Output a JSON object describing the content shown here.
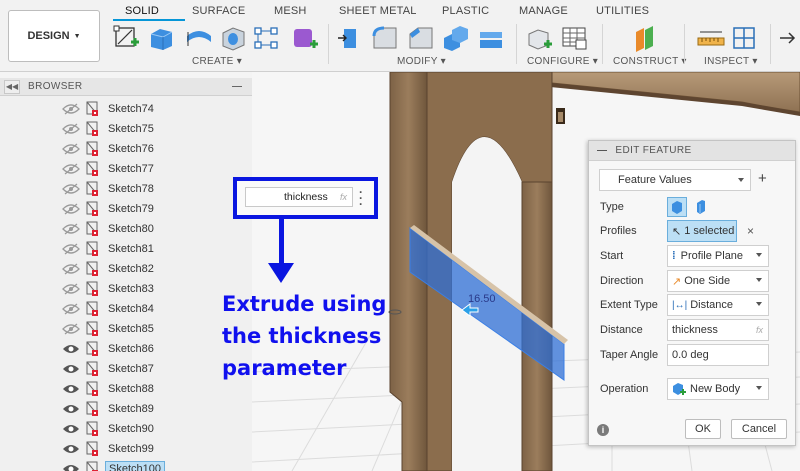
{
  "toolbar": {
    "workspace_label": "DESIGN",
    "tabs": [
      "SOLID",
      "SURFACE",
      "MESH",
      "SHEET METAL",
      "PLASTIC",
      "MANAGE",
      "UTILITIES"
    ],
    "active_tab": "SOLID",
    "groups": [
      "CREATE",
      "MODIFY",
      "CONFIGURE",
      "CONSTRUCT",
      "INSPECT"
    ],
    "accent_color": "#0696d7"
  },
  "browser": {
    "title": "BROWSER",
    "items": [
      {
        "label": "Sketch74",
        "visible": false
      },
      {
        "label": "Sketch75",
        "visible": false
      },
      {
        "label": "Sketch76",
        "visible": false
      },
      {
        "label": "Sketch77",
        "visible": false
      },
      {
        "label": "Sketch78",
        "visible": false
      },
      {
        "label": "Sketch79",
        "visible": false
      },
      {
        "label": "Sketch80",
        "visible": false
      },
      {
        "label": "Sketch81",
        "visible": false
      },
      {
        "label": "Sketch82",
        "visible": false
      },
      {
        "label": "Sketch83",
        "visible": false
      },
      {
        "label": "Sketch84",
        "visible": false
      },
      {
        "label": "Sketch85",
        "visible": false
      },
      {
        "label": "Sketch86",
        "visible": true
      },
      {
        "label": "Sketch87",
        "visible": true
      },
      {
        "label": "Sketch88",
        "visible": true
      },
      {
        "label": "Sketch89",
        "visible": true
      },
      {
        "label": "Sketch90",
        "visible": true
      },
      {
        "label": "Sketch99",
        "visible": true
      },
      {
        "label": "Sketch100",
        "visible": true,
        "selected": true
      }
    ]
  },
  "parameter_box": {
    "value": "thickness",
    "fx_label": "fx",
    "border_color": "#0a16e0"
  },
  "annotation": {
    "lines": [
      "Extrude using",
      "the thickness",
      "parameter"
    ],
    "color": "#1010ee"
  },
  "viewport": {
    "dimension_label": "16.50"
  },
  "edit_feature": {
    "title": "EDIT FEATURE",
    "feature_values": "Feature Values",
    "rows": {
      "type": "Type",
      "profiles_label": "Profiles",
      "profiles_value": "1 selected",
      "start_label": "Start",
      "start_value": "Profile Plane",
      "direction_label": "Direction",
      "direction_value": "One Side",
      "extent_label": "Extent Type",
      "extent_value": "Distance",
      "distance_label": "Distance",
      "distance_value": "thickness",
      "distance_fx": "fx",
      "taper_label": "Taper Angle",
      "taper_value": "0.0 deg",
      "operation_label": "Operation",
      "operation_value": "New Body"
    },
    "ok_label": "OK",
    "cancel_label": "Cancel"
  }
}
